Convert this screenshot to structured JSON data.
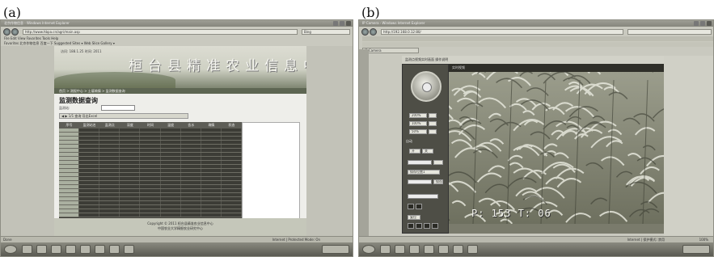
{
  "figure": {
    "label_a": "(a)",
    "label_b": "(b)"
  },
  "panel_a": {
    "window_title": "北京作物信息 - Windows Internet Explorer",
    "address": "http://www.hbpa.cn/agri/main.asp",
    "menu": "File  Edit  View  Favorites  Tools  Help",
    "favorites_bar": "Favorites   北京作物信息   百度一下   Suggested Sites ▾   Web Slice Gallery ▾",
    "search_engine": "Bing",
    "site_meta": "访问: 188.1.25   时间: 2011",
    "site_title": "桓台县精准农业信息中心",
    "breadcrumbs": "首页 > 测报中心 > 土壤墒情 > 监测数据查询",
    "query_title": "监测数据查询",
    "form_label": "监测站:",
    "toolbar_text": "◀ ▶ 1/1  查询   导出Excel",
    "table_headers": [
      "序号",
      "监测站名",
      "监测点",
      "深度",
      "时间",
      "温度",
      "含水",
      "墒情",
      "状态"
    ],
    "footer_line1": "Copyright © 2011 桓台县精准农业信息中心",
    "footer_line2": "中国农业大学精细农业研究中心",
    "status_left": "Done",
    "status_right": "Internet | Protected Mode: On"
  },
  "panel_b": {
    "window_title": "IP Camera - Windows Internet Explorer",
    "address": "http://192.168.0.12:80/",
    "tab_label": "IP Camera",
    "top_note": "监测点视频实时画面  操作说明",
    "video_header": "实时视频",
    "controls": [
      "200%",
      "100%",
      "50%",
      "自动",
      "开",
      "关",
      "保存位置1",
      "保存",
      "复位"
    ],
    "timestamp": "P: 153  T: 06",
    "status_right": "Internet | 保护模式: 禁用",
    "zoom": "100%"
  },
  "colors": {
    "tint": "#c9c9bf",
    "dark_panel": "#4e4e46",
    "banner_text": "#f7f7f2"
  }
}
